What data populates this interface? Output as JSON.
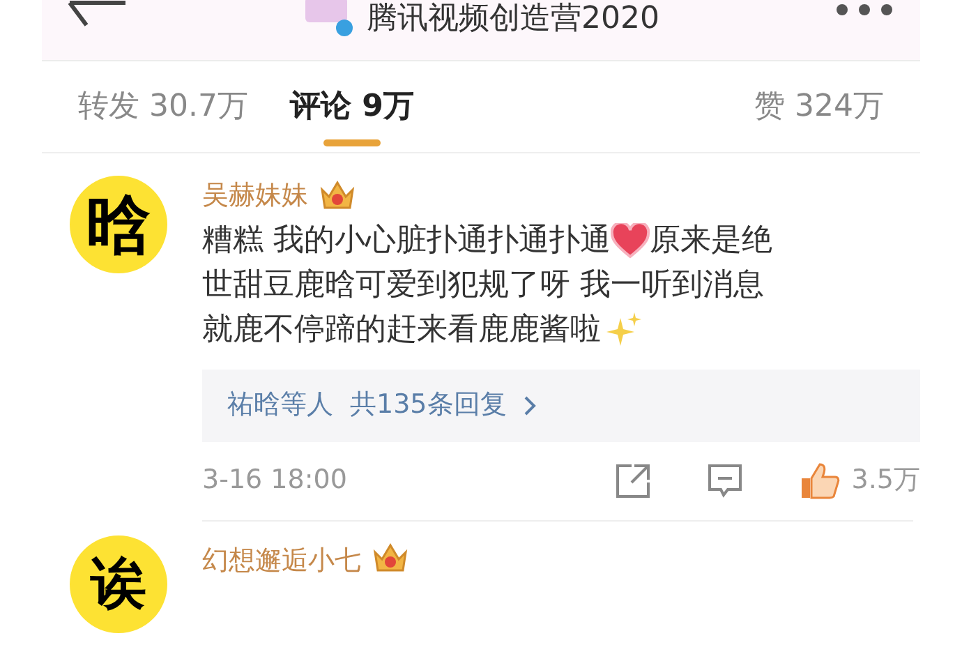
{
  "header": {
    "title": "腾讯视频创造营2020"
  },
  "tabs": [
    {
      "label": "转发 30.7万",
      "selected": false
    },
    {
      "label": "评论 9万",
      "selected": true
    },
    {
      "label": "赞 324万",
      "selected": false
    }
  ],
  "comments": [
    {
      "avatar_text": "晗",
      "name": "吴赫妹妹",
      "lines": [
        [
          {
            "kind": "text",
            "text": "糟糕 我的小心脏扑通扑通扑通"
          },
          {
            "kind": "heart"
          },
          {
            "kind": "text",
            "text": "原来是绝"
          }
        ],
        [
          {
            "kind": "text",
            "text": "世甜豆鹿晗可爱到犯规了呀 我一听到消息"
          }
        ],
        [
          {
            "kind": "text",
            "text": "就鹿不停蹄的赶来看鹿鹿酱啦"
          },
          {
            "kind": "sparkle"
          }
        ]
      ],
      "reply_names": "祐晗等人",
      "reply_count": "共135条回复",
      "time": "3-16 18:00",
      "likes": "3.5万"
    },
    {
      "avatar_text": "诶",
      "name": "幻想邂逅小七"
    }
  ]
}
